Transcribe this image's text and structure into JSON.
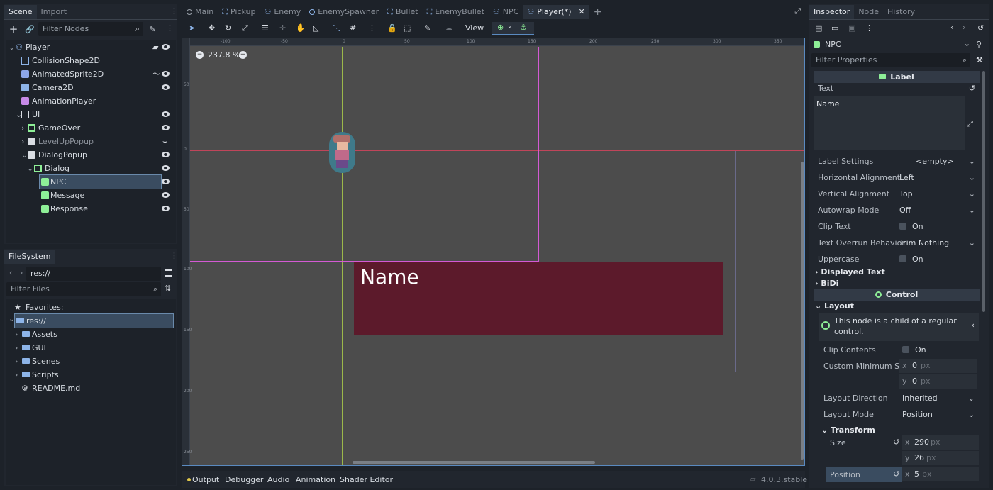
{
  "left_top_tabs": [
    "Scene",
    "Import"
  ],
  "scene": {
    "add_icon": "plus-icon",
    "filter_placeholder": "Filter Nodes",
    "tree": [
      {
        "label": "Player",
        "depth": 0,
        "icon": "character-icon"
      },
      {
        "label": "CollisionShape2D",
        "depth": 1,
        "icon": "collision-icon"
      },
      {
        "label": "AnimatedSprite2D",
        "depth": 1,
        "icon": "sprite-icon"
      },
      {
        "label": "Camera2D",
        "depth": 1,
        "icon": "camera-icon"
      },
      {
        "label": "AnimationPlayer",
        "depth": 1,
        "icon": "animation-icon"
      },
      {
        "label": "UI",
        "depth": 1,
        "icon": "canvas-icon"
      },
      {
        "label": "GameOver",
        "depth": 2,
        "icon": "control-icon"
      },
      {
        "label": "LevelUpPopup",
        "depth": 2,
        "icon": "popup-icon"
      },
      {
        "label": "DialogPopup",
        "depth": 2,
        "icon": "popup-icon"
      },
      {
        "label": "Dialog",
        "depth": 3,
        "icon": "control-icon"
      },
      {
        "label": "NPC",
        "depth": 4,
        "icon": "label-icon"
      },
      {
        "label": "Message",
        "depth": 4,
        "icon": "label-icon"
      },
      {
        "label": "Response",
        "depth": 4,
        "icon": "label-icon"
      }
    ]
  },
  "filesystem": {
    "tab": "FileSystem",
    "path": "res://",
    "filter_placeholder": "Filter Files",
    "favorites": "Favorites:",
    "root": "res://",
    "items": [
      "Assets",
      "GUI",
      "Scenes",
      "Scripts",
      "README.md"
    ]
  },
  "editor_tabs": [
    "Main",
    "Pickup",
    "Enemy",
    "EnemySpawner",
    "Bullet",
    "EnemyBullet",
    "NPC",
    "Player(*)"
  ],
  "toolbar": {
    "view_label": "View"
  },
  "viewport": {
    "zoom": "237.8 %",
    "label_text": "Name",
    "ruler_top": [
      "-100",
      "-50",
      "0",
      "50",
      "100",
      "150",
      "200",
      "250",
      "300",
      "350"
    ],
    "ruler_left": [
      "50",
      "0",
      "50",
      "100",
      "150",
      "200",
      "250"
    ]
  },
  "bottom_tabs": [
    "Output",
    "Debugger",
    "Audio",
    "Animation",
    "Shader Editor"
  ],
  "version": "4.0.3.stable",
  "inspector": {
    "tabs": [
      "Inspector",
      "Node",
      "History"
    ],
    "node_name": "NPC",
    "filter_placeholder": "Filter Properties",
    "section_label": "Label",
    "text_key": "Text",
    "text_value": "Name",
    "rows": [
      {
        "k": "Label Settings",
        "v": "<empty>"
      },
      {
        "k": "Horizontal Alignment",
        "v": "Left"
      },
      {
        "k": "Vertical Alignment",
        "v": "Top"
      },
      {
        "k": "Autowrap Mode",
        "v": "Off"
      },
      {
        "k": "Clip Text",
        "v": "On"
      },
      {
        "k": "Text Overrun Behavior",
        "v": "Trim Nothing"
      },
      {
        "k": "Uppercase",
        "v": "On"
      }
    ],
    "displayed_text": "Displayed Text",
    "bidi": "BiDi",
    "section_control": "Control",
    "layout": "Layout",
    "info": "This node is a child of a regular control.",
    "clip_contents": "Clip Contents",
    "clip_contents_v": "On",
    "custom_min": "Custom Minimum S...",
    "cms_x": "0",
    "cms_y": "0",
    "px": "px",
    "layout_direction": "Layout Direction",
    "layout_direction_v": "Inherited",
    "layout_mode": "Layout Mode",
    "layout_mode_v": "Position",
    "transform": "Transform",
    "size": "Size",
    "size_x": "290",
    "size_y": "26",
    "position": "Position",
    "pos_x": "5",
    "x": "x",
    "y": "y"
  },
  "colors": {
    "accent": "#5a8ac0",
    "label_bg": "#5c1a2b",
    "selection": "#3a4c60"
  }
}
